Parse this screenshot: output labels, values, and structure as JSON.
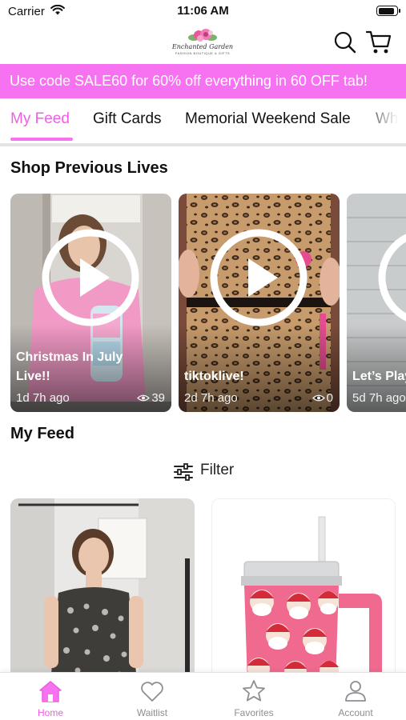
{
  "status_bar": {
    "carrier": "Carrier",
    "time": "11:06 AM",
    "icons": [
      "wifi-icon",
      "battery-icon"
    ]
  },
  "header": {
    "logo_text": "Enchanted Garden",
    "logo_subtext": "FASHION BOUTIQUE & GIFTS",
    "search_icon": "search-icon",
    "cart_icon": "cart-icon"
  },
  "promo_banner": {
    "text": "Use code SALE60 for 60% off everything in 60 OFF tab!",
    "background": "#f772f0",
    "text_color": "#ffffff"
  },
  "tabs": [
    {
      "label": "My Feed",
      "active": true
    },
    {
      "label": "Gift Cards",
      "active": false
    },
    {
      "label": "Memorial Weekend Sale",
      "active": false
    },
    {
      "label": "Wh",
      "active": false
    }
  ],
  "accent_color": "#ee5fe2",
  "shop_previous_lives": {
    "title": "Shop Previous Lives",
    "cards": [
      {
        "title": "Christmas In July Live!!",
        "age": "1d 7h ago",
        "views": "39"
      },
      {
        "title": "tiktoklive!",
        "age": "2d 7h ago",
        "views": "0"
      },
      {
        "title": "Let’s Play",
        "age": "5d 7h ago",
        "views": ""
      }
    ]
  },
  "my_feed": {
    "title": "My Feed",
    "filter_label": "Filter",
    "filter_icon": "sliders-icon",
    "products": [
      {
        "image": "woman-in-leopard-top-photo"
      },
      {
        "image": "santa-print-tumbler-photo"
      }
    ]
  },
  "tab_bar": {
    "items": [
      {
        "label": "Home",
        "icon": "home-icon",
        "active": true
      },
      {
        "label": "Waitlist",
        "icon": "heart-icon",
        "active": false
      },
      {
        "label": "Favorites",
        "icon": "star-icon",
        "active": false
      },
      {
        "label": "Account",
        "icon": "person-icon",
        "active": false
      }
    ]
  }
}
